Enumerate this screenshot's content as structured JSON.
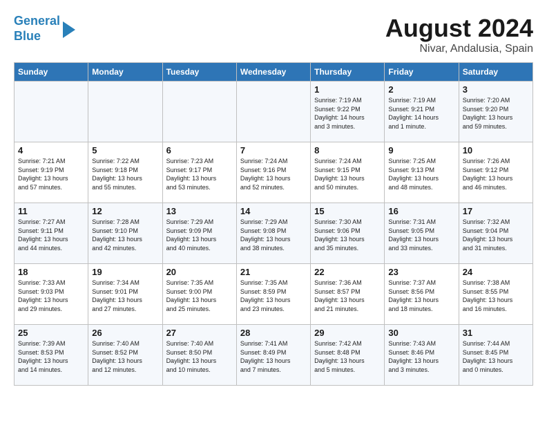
{
  "header": {
    "logo_line1": "General",
    "logo_line2": "Blue",
    "main_title": "August 2024",
    "subtitle": "Nivar, Andalusia, Spain"
  },
  "calendar": {
    "days_of_week": [
      "Sunday",
      "Monday",
      "Tuesday",
      "Wednesday",
      "Thursday",
      "Friday",
      "Saturday"
    ],
    "weeks": [
      [
        {
          "day": "",
          "info": ""
        },
        {
          "day": "",
          "info": ""
        },
        {
          "day": "",
          "info": ""
        },
        {
          "day": "",
          "info": ""
        },
        {
          "day": "1",
          "info": "Sunrise: 7:19 AM\nSunset: 9:22 PM\nDaylight: 14 hours\nand 3 minutes."
        },
        {
          "day": "2",
          "info": "Sunrise: 7:19 AM\nSunset: 9:21 PM\nDaylight: 14 hours\nand 1 minute."
        },
        {
          "day": "3",
          "info": "Sunrise: 7:20 AM\nSunset: 9:20 PM\nDaylight: 13 hours\nand 59 minutes."
        }
      ],
      [
        {
          "day": "4",
          "info": "Sunrise: 7:21 AM\nSunset: 9:19 PM\nDaylight: 13 hours\nand 57 minutes."
        },
        {
          "day": "5",
          "info": "Sunrise: 7:22 AM\nSunset: 9:18 PM\nDaylight: 13 hours\nand 55 minutes."
        },
        {
          "day": "6",
          "info": "Sunrise: 7:23 AM\nSunset: 9:17 PM\nDaylight: 13 hours\nand 53 minutes."
        },
        {
          "day": "7",
          "info": "Sunrise: 7:24 AM\nSunset: 9:16 PM\nDaylight: 13 hours\nand 52 minutes."
        },
        {
          "day": "8",
          "info": "Sunrise: 7:24 AM\nSunset: 9:15 PM\nDaylight: 13 hours\nand 50 minutes."
        },
        {
          "day": "9",
          "info": "Sunrise: 7:25 AM\nSunset: 9:13 PM\nDaylight: 13 hours\nand 48 minutes."
        },
        {
          "day": "10",
          "info": "Sunrise: 7:26 AM\nSunset: 9:12 PM\nDaylight: 13 hours\nand 46 minutes."
        }
      ],
      [
        {
          "day": "11",
          "info": "Sunrise: 7:27 AM\nSunset: 9:11 PM\nDaylight: 13 hours\nand 44 minutes."
        },
        {
          "day": "12",
          "info": "Sunrise: 7:28 AM\nSunset: 9:10 PM\nDaylight: 13 hours\nand 42 minutes."
        },
        {
          "day": "13",
          "info": "Sunrise: 7:29 AM\nSunset: 9:09 PM\nDaylight: 13 hours\nand 40 minutes."
        },
        {
          "day": "14",
          "info": "Sunrise: 7:29 AM\nSunset: 9:08 PM\nDaylight: 13 hours\nand 38 minutes."
        },
        {
          "day": "15",
          "info": "Sunrise: 7:30 AM\nSunset: 9:06 PM\nDaylight: 13 hours\nand 35 minutes."
        },
        {
          "day": "16",
          "info": "Sunrise: 7:31 AM\nSunset: 9:05 PM\nDaylight: 13 hours\nand 33 minutes."
        },
        {
          "day": "17",
          "info": "Sunrise: 7:32 AM\nSunset: 9:04 PM\nDaylight: 13 hours\nand 31 minutes."
        }
      ],
      [
        {
          "day": "18",
          "info": "Sunrise: 7:33 AM\nSunset: 9:03 PM\nDaylight: 13 hours\nand 29 minutes."
        },
        {
          "day": "19",
          "info": "Sunrise: 7:34 AM\nSunset: 9:01 PM\nDaylight: 13 hours\nand 27 minutes."
        },
        {
          "day": "20",
          "info": "Sunrise: 7:35 AM\nSunset: 9:00 PM\nDaylight: 13 hours\nand 25 minutes."
        },
        {
          "day": "21",
          "info": "Sunrise: 7:35 AM\nSunset: 8:59 PM\nDaylight: 13 hours\nand 23 minutes."
        },
        {
          "day": "22",
          "info": "Sunrise: 7:36 AM\nSunset: 8:57 PM\nDaylight: 13 hours\nand 21 minutes."
        },
        {
          "day": "23",
          "info": "Sunrise: 7:37 AM\nSunset: 8:56 PM\nDaylight: 13 hours\nand 18 minutes."
        },
        {
          "day": "24",
          "info": "Sunrise: 7:38 AM\nSunset: 8:55 PM\nDaylight: 13 hours\nand 16 minutes."
        }
      ],
      [
        {
          "day": "25",
          "info": "Sunrise: 7:39 AM\nSunset: 8:53 PM\nDaylight: 13 hours\nand 14 minutes."
        },
        {
          "day": "26",
          "info": "Sunrise: 7:40 AM\nSunset: 8:52 PM\nDaylight: 13 hours\nand 12 minutes."
        },
        {
          "day": "27",
          "info": "Sunrise: 7:40 AM\nSunset: 8:50 PM\nDaylight: 13 hours\nand 10 minutes."
        },
        {
          "day": "28",
          "info": "Sunrise: 7:41 AM\nSunset: 8:49 PM\nDaylight: 13 hours\nand 7 minutes."
        },
        {
          "day": "29",
          "info": "Sunrise: 7:42 AM\nSunset: 8:48 PM\nDaylight: 13 hours\nand 5 minutes."
        },
        {
          "day": "30",
          "info": "Sunrise: 7:43 AM\nSunset: 8:46 PM\nDaylight: 13 hours\nand 3 minutes."
        },
        {
          "day": "31",
          "info": "Sunrise: 7:44 AM\nSunset: 8:45 PM\nDaylight: 13 hours\nand 0 minutes."
        }
      ]
    ]
  }
}
